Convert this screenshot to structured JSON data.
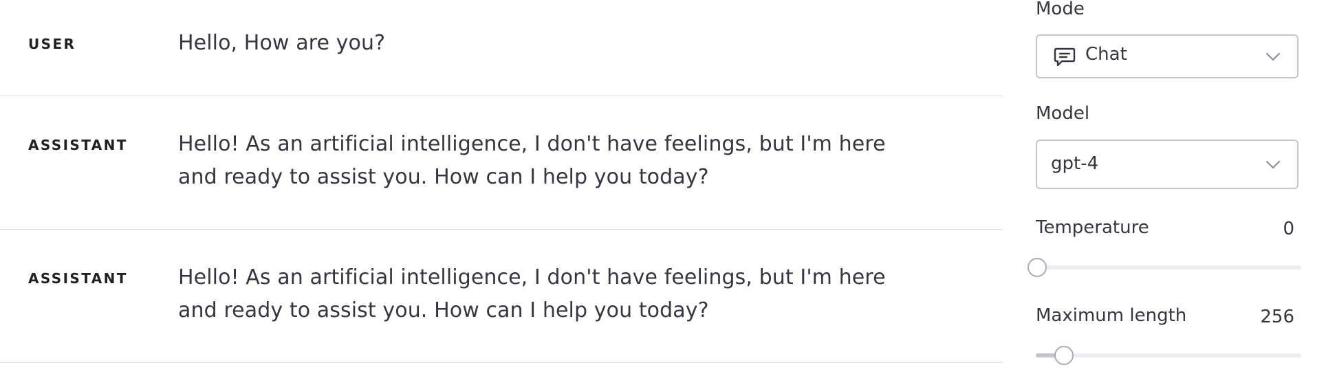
{
  "messages": [
    {
      "role": "USER",
      "content": "Hello, How are you?"
    },
    {
      "role": "ASSISTANT",
      "content": "Hello! As an artificial intelligence, I don't have feelings, but I'm here and ready to assist you. How can I help you today?"
    },
    {
      "role": "ASSISTANT",
      "content": "Hello! As an artificial intelligence, I don't have feelings, but I'm here and ready to assist you. How can I help you today?"
    }
  ],
  "settings": {
    "mode": {
      "label": "Mode",
      "value": "Chat",
      "icon": "chat-bubble-icon"
    },
    "model": {
      "label": "Model",
      "value": "gpt-4"
    },
    "temperature": {
      "label": "Temperature",
      "value": "0",
      "fraction": 0
    },
    "max_length": {
      "label": "Maximum length",
      "value": "256",
      "fraction": 0.1
    }
  },
  "colors": {
    "text": "#353740",
    "border": "#c5c5d2",
    "divider": "#d9d9e3",
    "track": "#ececf1"
  }
}
